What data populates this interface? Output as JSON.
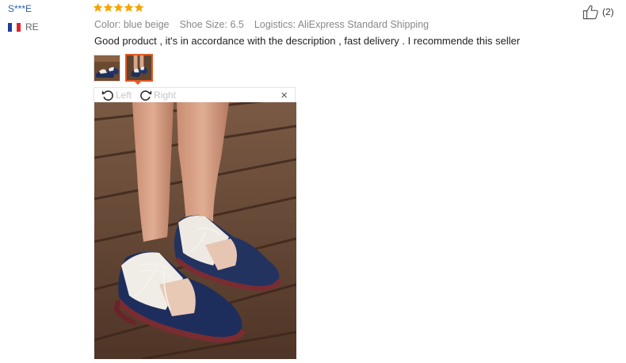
{
  "reviewer": {
    "name": "S***E",
    "country_code": "RE"
  },
  "review": {
    "rating": 5,
    "rating_max": 5,
    "color": "Color: blue beige",
    "shoe_size": "Shoe Size: 6.5",
    "logistics": "Logistics: AliExpress Standard Shipping",
    "text": "Good product , it's in accordance with the description , fast delivery . I recommende this seller"
  },
  "helpful": {
    "count": "(2)",
    "icon": "thumbs-up-icon"
  },
  "thumbnails": {
    "count": 2,
    "selected_index": 2
  },
  "viewer": {
    "rotate_left_label": "Left",
    "rotate_right_label": "Right",
    "close_label": "×"
  },
  "colors": {
    "link_blue": "#2a5ea9",
    "star_orange": "#f7a400",
    "selected_border": "#e35a24"
  }
}
